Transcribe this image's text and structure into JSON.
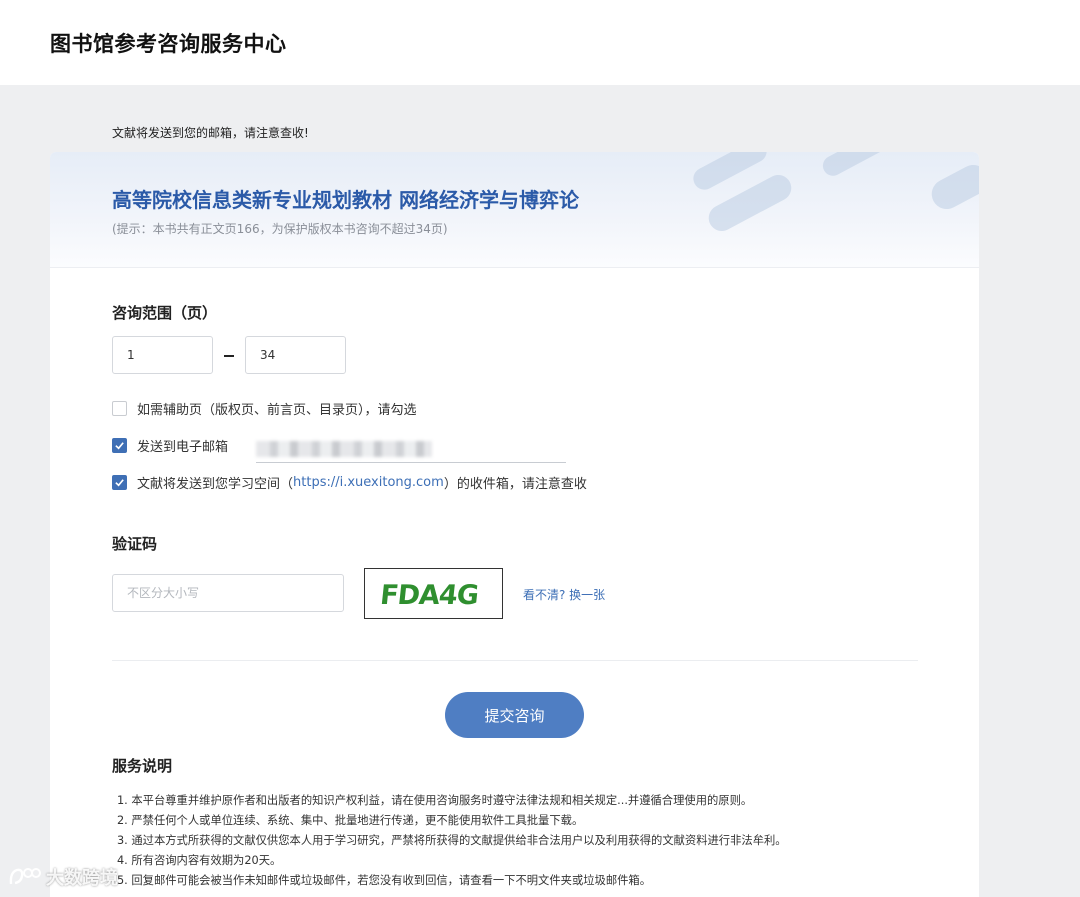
{
  "header": {
    "site_title": "图书馆参考咨询服务中心"
  },
  "notice": "文献将发送到您的邮箱，请注意查收!",
  "book": {
    "title": "高等院校信息类新专业规划教材 网络经济学与博弈论",
    "hint": "(提示：本书共有正文页166，为保护版权本书咨询不超过34页)"
  },
  "range": {
    "label": "咨询范围（页）",
    "from": "1",
    "to": "34"
  },
  "options": {
    "aux_pages": {
      "label": "如需辅助页（版权页、前言页、目录页），请勾选",
      "checked": false
    },
    "send_email": {
      "label": "发送到电子邮箱",
      "checked": true
    },
    "study_space": {
      "prefix": "文献将发送到您学习空间（",
      "link": "https://i.xuexitong.com",
      "suffix": "）的收件箱，请注意查收",
      "checked": true
    }
  },
  "captcha": {
    "label": "验证码",
    "placeholder": "不区分大小写",
    "image_text": "FDA4G",
    "refresh": "看不清? 换一张"
  },
  "submit": "提交咨询",
  "service": {
    "title": "服务说明",
    "items": [
      "1. 本平台尊重并维护原作者和出版者的知识产权利益，请在使用咨询服务时遵守法律法规和相关规定...并遵循合理使用的原则。",
      "2. 严禁任何个人或单位连续、系统、集中、批量地进行传递，更不能使用软件工具批量下载。",
      "3. 通过本方式所获得的文献仅供您本人用于学习研究，严禁将所获得的文献提供给非合法用户以及利用获得的文献资料进行非法牟利。",
      "4. 所有咨询内容有效期为20天。",
      "5. 回复邮件可能会被当作未知邮件或垃圾邮件，若您没有收到回信，请查看一下不明文件夹或垃圾邮件箱。"
    ]
  },
  "watermark": "大数跨境",
  "colors": {
    "accent": "#4f7ec3",
    "title_blue": "#2b5aa8",
    "link": "#3d6fb6",
    "captcha_green": "#2f8f2f"
  },
  "icons": {
    "check": "check-icon",
    "watermark_logo": "logo-icon"
  }
}
